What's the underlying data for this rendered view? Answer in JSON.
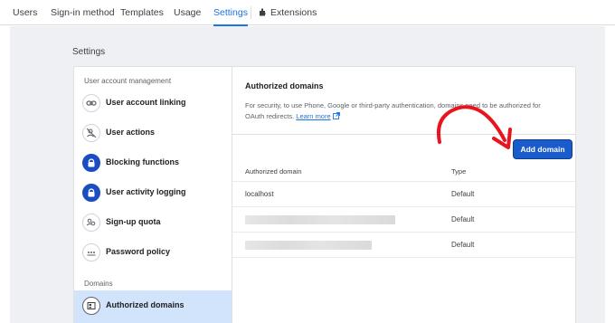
{
  "tabs": [
    {
      "label": "Users"
    },
    {
      "label": "Sign-in method"
    },
    {
      "label": "Templates"
    },
    {
      "label": "Usage"
    },
    {
      "label": "Settings"
    },
    {
      "label": "Extensions"
    }
  ],
  "page_title": "Settings",
  "nav": {
    "section_user": "User account management",
    "items": [
      {
        "label": "User account linking",
        "icon": "link-icon"
      },
      {
        "label": "User actions",
        "icon": "person-off-icon"
      },
      {
        "label": "Blocking functions",
        "icon": "lock-icon"
      },
      {
        "label": "User activity logging",
        "icon": "lock-icon"
      },
      {
        "label": "Sign-up quota",
        "icon": "people-icon"
      },
      {
        "label": "Password policy",
        "icon": "password-icon"
      }
    ],
    "section_domains": "Domains",
    "active_item": {
      "label": "Authorized domains",
      "icon": "domain-icon"
    }
  },
  "content": {
    "title": "Authorized domains",
    "description": "For security, to use Phone, Google or third-party authentication, domains need to be authorized for OAuth redirects.",
    "learn_more": "Learn more",
    "add_button": "Add domain",
    "table": {
      "headers": [
        "Authorized domain",
        "Type"
      ],
      "rows": [
        {
          "domain": "localhost",
          "type": "Default"
        },
        {
          "domain": "",
          "type": "Default",
          "redacted": true
        },
        {
          "domain": "",
          "type": "Default",
          "redacted": true
        }
      ]
    }
  },
  "colors": {
    "accent": "#1a73e8",
    "button": "#1a5ccc",
    "annotation": "#e8141e",
    "active_nav": "#d2e3fc"
  }
}
